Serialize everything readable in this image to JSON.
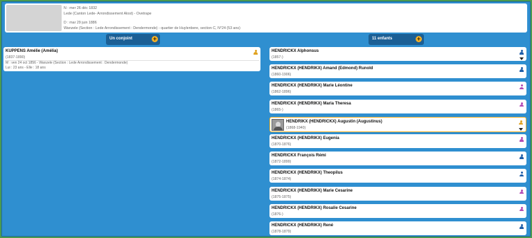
{
  "top": {
    "line1": "N : mer 26 déc 1832",
    "line2": "Lede (Canton Lede- Arrondissement Alost) - Ovetrape",
    "line3": "D : mar 29 juin 1886",
    "line4": "Wanzele (Section : Lede Arrondissement : Dendermonde) - quartier de Huylenbere, section C, N°24 (53 ans)"
  },
  "tabs": {
    "spouse_label": "Un conjoint",
    "children_label": "11 enfants",
    "plus": "+"
  },
  "spouse": {
    "name": "KUPPENS Amélie (Amélia)",
    "dates": "(1837-1890)",
    "marriage": "M : ven 24 oct 1856 - Wanzele (Section : Lede Arrondissement : Dendermonde)",
    "ages": "Lui : 23 ans - Elle : 18 ans"
  },
  "children": [
    {
      "name": "HENDRICKX Alphonsus",
      "dates": "(1857-)",
      "gender": "male"
    },
    {
      "name": "HENDRICKX (HENDRIKX) Amand (Edmond) Runold",
      "dates": "(1860-1906)",
      "gender": "male"
    },
    {
      "name": "HENDRICKX (HENDRIKX) Marie Léontine",
      "dates": "(1862-1896)",
      "gender": "female"
    },
    {
      "name": "HENDRICKX (HENDRIKX) Maria Theresa",
      "dates": "(1865-)",
      "gender": "female"
    },
    {
      "name": "HENDRIKX (HENDRICKX) Augustin (Augustinus)",
      "dates": "(1868-1940)",
      "gender": "self"
    },
    {
      "name": "HENDRICKX (HENDRIKX) Eugenia",
      "dates": "(1870-1876)",
      "gender": "female"
    },
    {
      "name": "HENDRICKX François Rémi",
      "dates": "(1872-1899)",
      "gender": "male"
    },
    {
      "name": "HENDRICKX (HENDRIKX) Theopilus",
      "dates": "(1874-1874)",
      "gender": "male"
    },
    {
      "name": "HENDRICKX (HENDRIKX) Marie Cesarine",
      "dates": "(1875-1875)",
      "gender": "female"
    },
    {
      "name": "HENDRICKX (HENDRIKX) Rosalie Cesarine",
      "dates": "(1876-)",
      "gender": "female"
    },
    {
      "name": "HENDRICKX (HENDRIKX) René",
      "dates": "(1878-1879)",
      "gender": "male"
    }
  ],
  "colors": {
    "background": "#2f8fd0",
    "outer_border": "#4b9a4f",
    "tab": "#1b5f95",
    "plus": "#f5b027",
    "male": "#1f5ea8",
    "female": "#b24bb5",
    "self": "#e0a21f",
    "selected_border": "#f0b02a"
  }
}
